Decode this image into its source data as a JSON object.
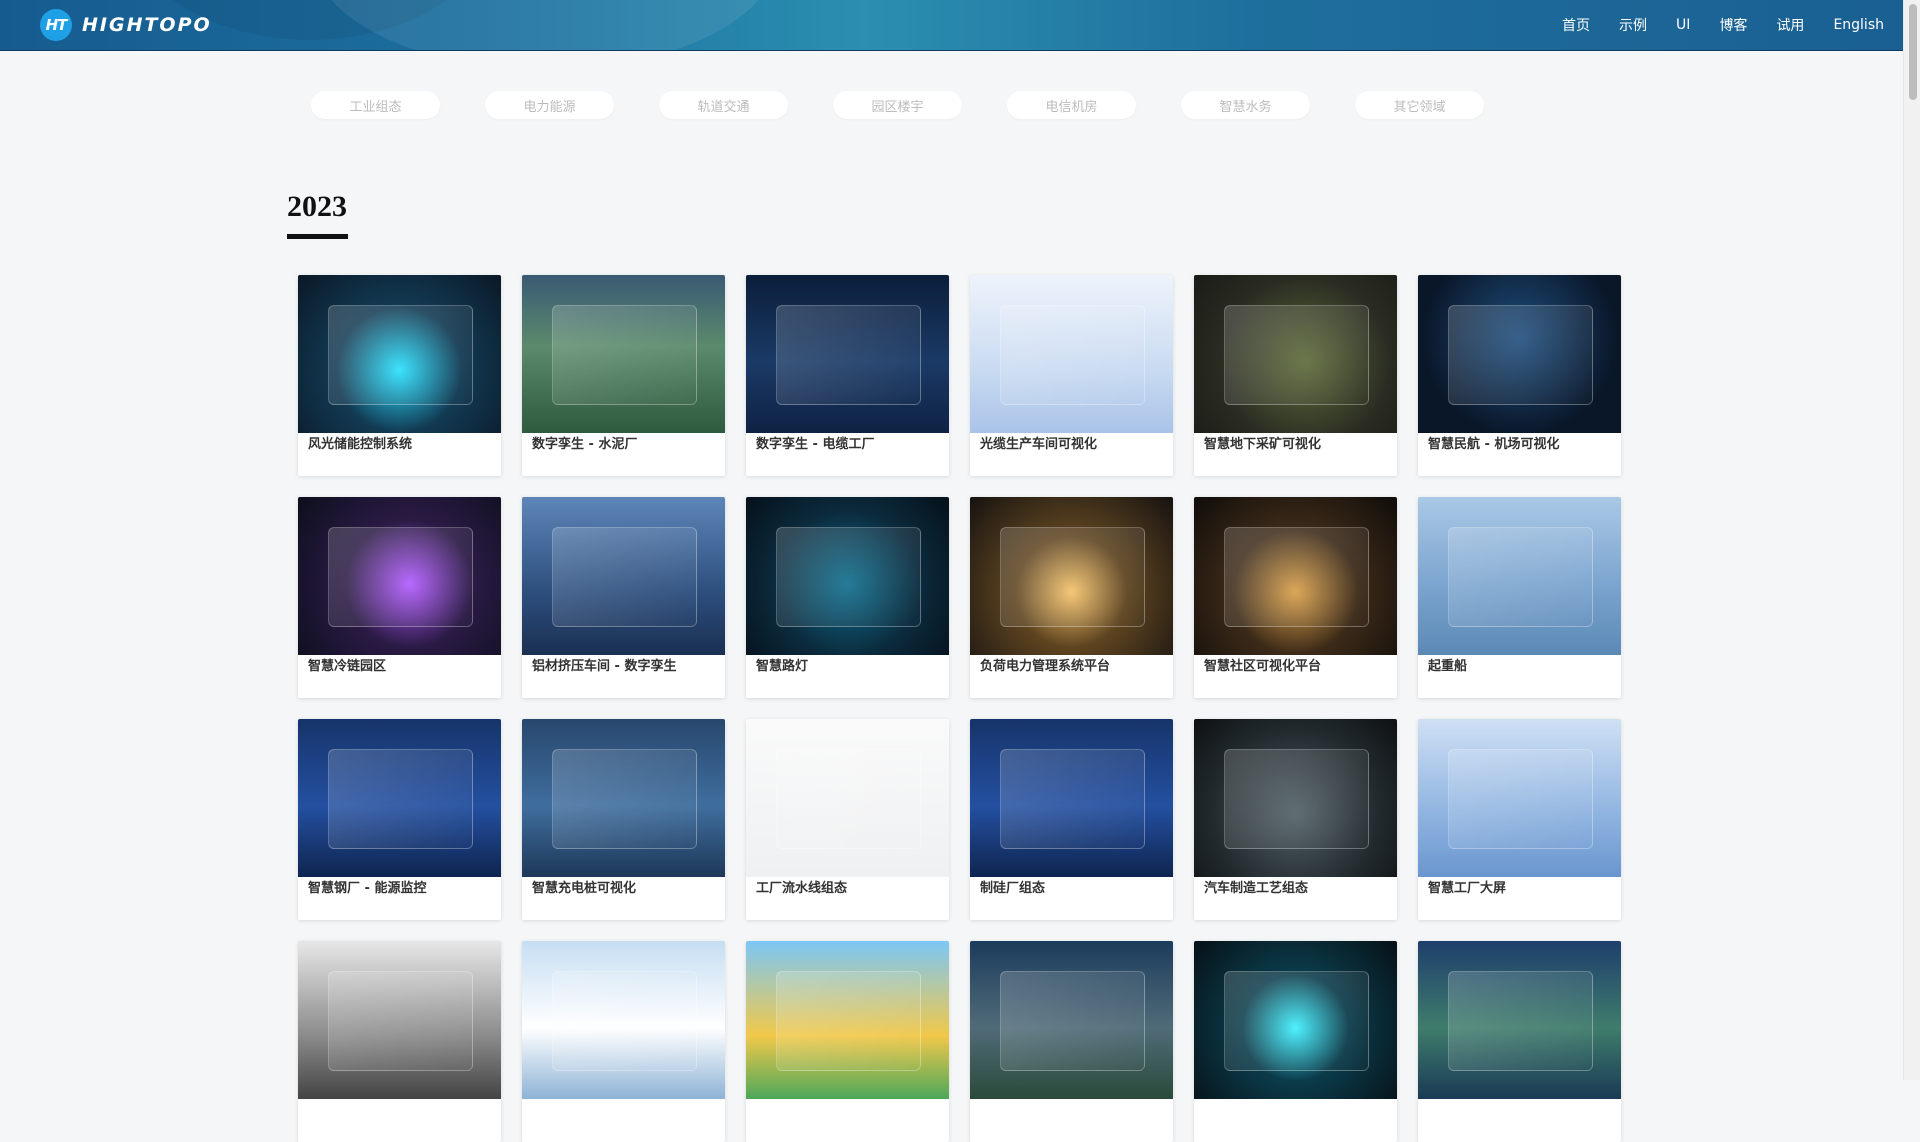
{
  "header": {
    "logo_mark": "HT",
    "logo_text": "HIGHTOPO",
    "nav": [
      "首页",
      "示例",
      "UI",
      "博客",
      "试用",
      "English"
    ]
  },
  "filters": [
    "工业组态",
    "电力能源",
    "轨道交通",
    "园区楼宇",
    "电信机房",
    "智慧水务",
    "其它领域"
  ],
  "section": {
    "year": "2023"
  },
  "cards": [
    {
      "title": "风光储能控制系统",
      "theme": "t-cyan",
      "icon": "energy-storage-thumbnail"
    },
    {
      "title": "数字孪生 - 水泥厂",
      "theme": "t-green",
      "icon": "cement-factory-thumbnail"
    },
    {
      "title": "数字孪生 - 电缆工厂",
      "theme": "t-navy",
      "icon": "cable-factory-thumbnail"
    },
    {
      "title": "光缆生产车间可视化",
      "theme": "t-light",
      "icon": "optical-cable-workshop-thumbnail"
    },
    {
      "title": "智慧地下采矿可视化",
      "theme": "t-brown",
      "icon": "underground-mining-thumbnail"
    },
    {
      "title": "智慧民航 - 机场可视化",
      "theme": "t-night",
      "icon": "airport-thumbnail"
    },
    {
      "title": "智慧冷链园区",
      "theme": "t-purple",
      "icon": "cold-chain-park-thumbnail"
    },
    {
      "title": "铝材挤压车间 - 数字孪生",
      "theme": "t-bluegray",
      "icon": "aluminum-extrusion-thumbnail"
    },
    {
      "title": "智慧路灯",
      "theme": "t-dark",
      "icon": "street-light-thumbnail"
    },
    {
      "title": "负荷电力管理系统平台",
      "theme": "t-gold",
      "icon": "power-management-thumbnail"
    },
    {
      "title": "智慧社区可视化平台",
      "theme": "t-city",
      "icon": "smart-community-thumbnail"
    },
    {
      "title": "起重船",
      "theme": "t-sea",
      "icon": "crane-ship-thumbnail"
    },
    {
      "title": "智慧钢厂 - 能源监控",
      "theme": "t-factory",
      "icon": "steel-plant-thumbnail"
    },
    {
      "title": "智慧充电桩可视化",
      "theme": "t-steel",
      "icon": "charging-pile-thumbnail"
    },
    {
      "title": "工厂流水线组态",
      "theme": "t-white",
      "icon": "assembly-line-thumbnail"
    },
    {
      "title": "制硅厂组态",
      "theme": "t-factory",
      "icon": "silicon-plant-thumbnail"
    },
    {
      "title": "汽车制造工艺组态",
      "theme": "t-car",
      "icon": "car-manufacturing-thumbnail"
    },
    {
      "title": "智慧工厂大屏",
      "theme": "t-map",
      "icon": "factory-dashboard-thumbnail"
    },
    {
      "title": "",
      "theme": "t-office",
      "icon": "office-thumbnail"
    },
    {
      "title": "",
      "theme": "t-ice",
      "icon": "curling-thumbnail"
    },
    {
      "title": "",
      "theme": "t-plane",
      "icon": "biplane-thumbnail"
    },
    {
      "title": "",
      "theme": "t-rail",
      "icon": "railway-thumbnail"
    },
    {
      "title": "",
      "theme": "t-holo",
      "icon": "hologram-building-thumbnail"
    },
    {
      "title": "",
      "theme": "t-farm",
      "icon": "smart-farm-thumbnail"
    }
  ]
}
